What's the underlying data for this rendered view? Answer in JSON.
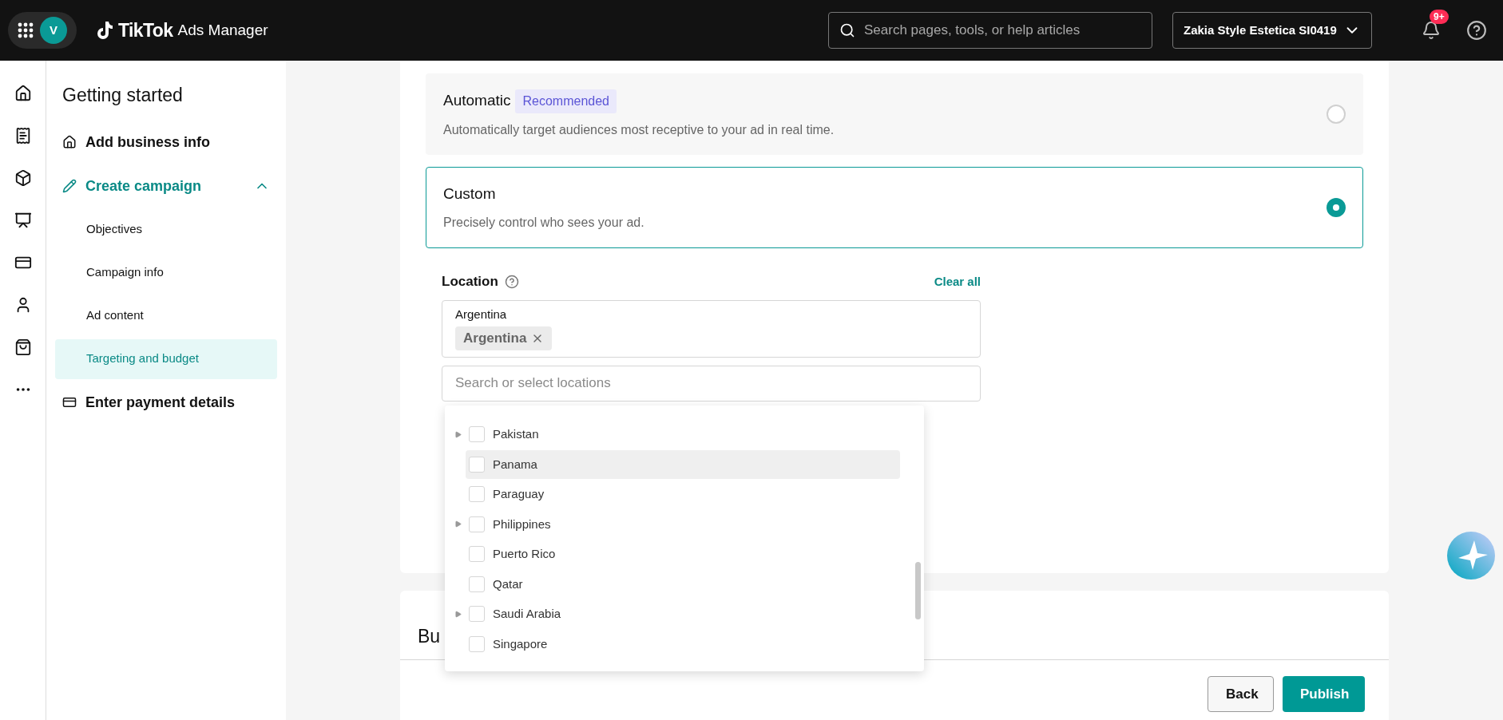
{
  "top_bar": {
    "avatar": "V",
    "logo": "TikTok",
    "product": "Ads Manager",
    "search": {
      "placeholder": "Search pages, tools, or help articles"
    },
    "account": "Zakia Style Estetica SI0419",
    "notifications": "9+"
  },
  "sidebar": {
    "title": "Getting started",
    "items": [
      {
        "label": "Add business info",
        "active": false
      },
      {
        "label": "Create campaign",
        "expanded": true,
        "active": true,
        "children": [
          {
            "label": "Objectives",
            "selected": false
          },
          {
            "label": "Campaign info",
            "selected": false
          },
          {
            "label": "Ad content",
            "selected": false
          },
          {
            "label": "Targeting and budget",
            "selected": true
          }
        ]
      },
      {
        "label": "Enter payment details",
        "active": false
      }
    ]
  },
  "targeting_options": [
    {
      "title": "Automatic",
      "badge": "Recommended",
      "description": "Automatically target audiences most receptive to your ad in real time.",
      "selected": false
    },
    {
      "title": "Custom",
      "description": "Precisely control who sees your ad.",
      "selected": true
    }
  ],
  "location": {
    "label": "Location",
    "clear": "Clear all",
    "selected_group": "Argentina",
    "tags": [
      "Argentina"
    ],
    "search": {
      "placeholder": "Search or select locations"
    },
    "options": [
      {
        "label": "Pakistan",
        "expandable": true,
        "checked": false,
        "highlighted": false
      },
      {
        "label": "Panama",
        "expandable": false,
        "checked": false,
        "highlighted": true
      },
      {
        "label": "Paraguay",
        "expandable": false,
        "checked": false,
        "highlighted": false
      },
      {
        "label": "Philippines",
        "expandable": true,
        "checked": false,
        "highlighted": false
      },
      {
        "label": "Puerto Rico",
        "expandable": false,
        "checked": false,
        "highlighted": false
      },
      {
        "label": "Qatar",
        "expandable": false,
        "checked": false,
        "highlighted": false
      },
      {
        "label": "Saudi Arabia",
        "expandable": true,
        "checked": false,
        "highlighted": false
      },
      {
        "label": "Singapore",
        "expandable": false,
        "checked": false,
        "highlighted": false
      }
    ]
  },
  "budget_section": {
    "heading": "Bu"
  },
  "buttons": [
    {
      "kind": "secondary",
      "label": "Back"
    },
    {
      "kind": "primary",
      "label": "Publish"
    }
  ]
}
